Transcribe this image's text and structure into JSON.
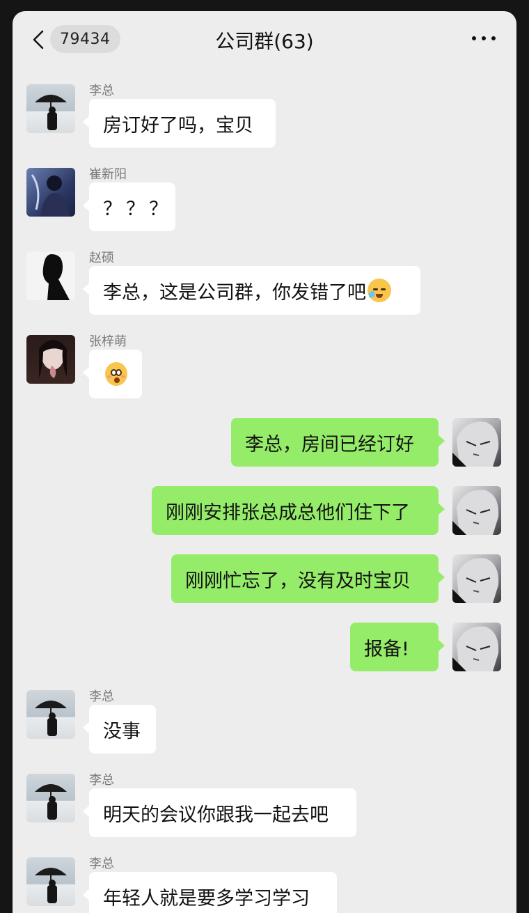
{
  "header": {
    "back_count": "79434",
    "title": "公司群(63)"
  },
  "messages": [
    {
      "sender": "李总",
      "text": "房订好了吗，宝贝"
    },
    {
      "sender": "崔新阳",
      "text": "？？？"
    },
    {
      "sender": "赵硕",
      "text": "李总，这是公司群，你发错了吧",
      "emoji": "tears-of-joy-emoji"
    },
    {
      "sender": "张梓萌",
      "emoji": "flushed-emoji"
    },
    {
      "text": "李总，房间已经订好"
    },
    {
      "text": "刚刚安排张总成总他们住下了"
    },
    {
      "text": "刚刚忙忘了，没有及时宝贝"
    },
    {
      "text": "报备!"
    },
    {
      "sender": "李总",
      "text": "没事"
    },
    {
      "sender": "李总",
      "text": "明天的会议你跟我一起去吧"
    },
    {
      "sender": "李总",
      "text": "年轻人就是要多学习学习"
    }
  ],
  "colors": {
    "background": "#ededed",
    "incoming_bubble": "#ffffff",
    "outgoing_bubble": "#95ec69",
    "name_text": "#777777"
  }
}
